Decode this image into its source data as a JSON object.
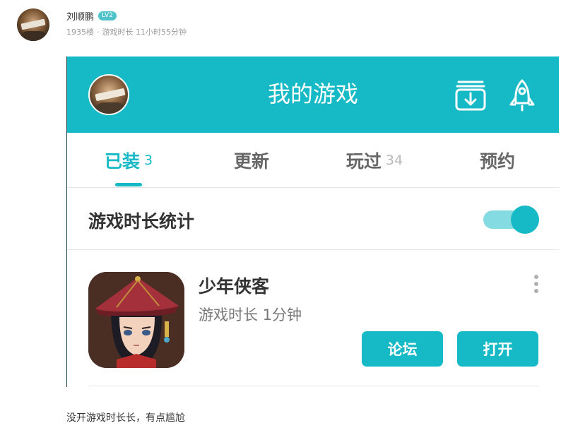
{
  "post": {
    "username": "刘顺鹏",
    "level": "LV2",
    "floor": "1935楼",
    "separator": "·",
    "playtime_meta": "游戏时长 11小时55分钟",
    "comment": "没开游戏时长长，有点尴尬"
  },
  "app": {
    "title": "我的游戏",
    "accent_color": "#16b9c6",
    "header_icons": [
      "download-box-icon",
      "rocket-icon"
    ],
    "tabs": [
      {
        "label": "已装",
        "count": "3",
        "active": true
      },
      {
        "label": "更新",
        "count": "",
        "active": false
      },
      {
        "label": "玩过",
        "count": "34",
        "active": false
      },
      {
        "label": "预约",
        "count": "",
        "active": false
      }
    ],
    "stats": {
      "label": "游戏时长统计",
      "toggle_on": true
    },
    "game": {
      "title": "少年侠客",
      "playtime": "游戏时长 1分钟",
      "forum_button": "论坛",
      "open_button": "打开"
    }
  }
}
